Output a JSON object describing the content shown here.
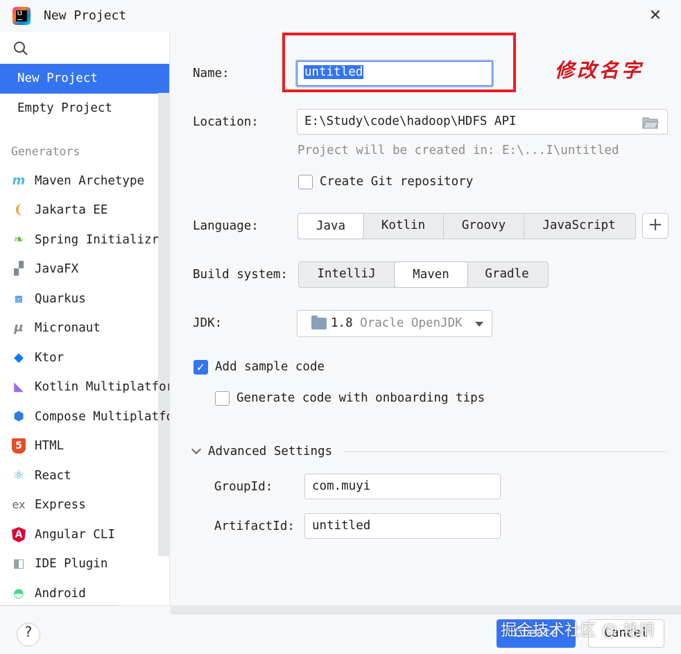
{
  "window": {
    "title": "New Project"
  },
  "sidebar": {
    "project_types": [
      {
        "label": "New Project",
        "selected": true
      },
      {
        "label": "Empty Project",
        "selected": false
      }
    ],
    "generators_header": "Generators",
    "generators": [
      {
        "label": "Maven Archetype",
        "icon": "maven-icon"
      },
      {
        "label": "Jakarta EE",
        "icon": "jakarta-ee-icon"
      },
      {
        "label": "Spring Initializr",
        "icon": "spring-icon"
      },
      {
        "label": "JavaFX",
        "icon": "javafx-icon"
      },
      {
        "label": "Quarkus",
        "icon": "quarkus-icon"
      },
      {
        "label": "Micronaut",
        "icon": "micronaut-icon"
      },
      {
        "label": "Ktor",
        "icon": "ktor-icon"
      },
      {
        "label": "Kotlin Multiplatform",
        "icon": "kotlin-icon"
      },
      {
        "label": "Compose Multiplatform",
        "icon": "compose-icon"
      },
      {
        "label": "HTML",
        "icon": "html5-icon"
      },
      {
        "label": "React",
        "icon": "react-icon"
      },
      {
        "label": "Express",
        "icon": "express-icon"
      },
      {
        "label": "Angular CLI",
        "icon": "angular-icon"
      },
      {
        "label": "IDE Plugin",
        "icon": "plugin-icon"
      },
      {
        "label": "Android",
        "icon": "android-icon"
      }
    ]
  },
  "form": {
    "name_label": "Name:",
    "name_value": "untitled",
    "location_label": "Location:",
    "location_value": "E:\\Study\\code\\hadoop\\HDFS API",
    "location_hint": "Project will be created in: E:\\...I\\untitled",
    "git_label": "Create Git repository",
    "git_checked": false,
    "language_label": "Language:",
    "languages": [
      "Java",
      "Kotlin",
      "Groovy",
      "JavaScript"
    ],
    "language_selected": "Java",
    "build_label": "Build system:",
    "build_systems": [
      "IntelliJ",
      "Maven",
      "Gradle"
    ],
    "build_selected": "Maven",
    "jdk_label": "JDK:",
    "jdk_version": "1.8",
    "jdk_vendor": "Oracle OpenJDK",
    "sample_code_label": "Add sample code",
    "sample_code_checked": true,
    "onboarding_label": "Generate code with onboarding tips",
    "onboarding_checked": false,
    "advanced_label": "Advanced Settings",
    "group_label": "GroupId:",
    "group_value": "com.muyi",
    "artifact_label": "ArtifactId:",
    "artifact_value": "untitled"
  },
  "annotation": {
    "text": "修改名字",
    "color": "#ec1c24"
  },
  "footer": {
    "help_label": "?",
    "create_label": "Create",
    "cancel_label": "Cancel",
    "watermark": "掘金技术社区 @ 艳桐"
  },
  "colors": {
    "accent": "#3574f0",
    "background": "#f7f8fa"
  }
}
